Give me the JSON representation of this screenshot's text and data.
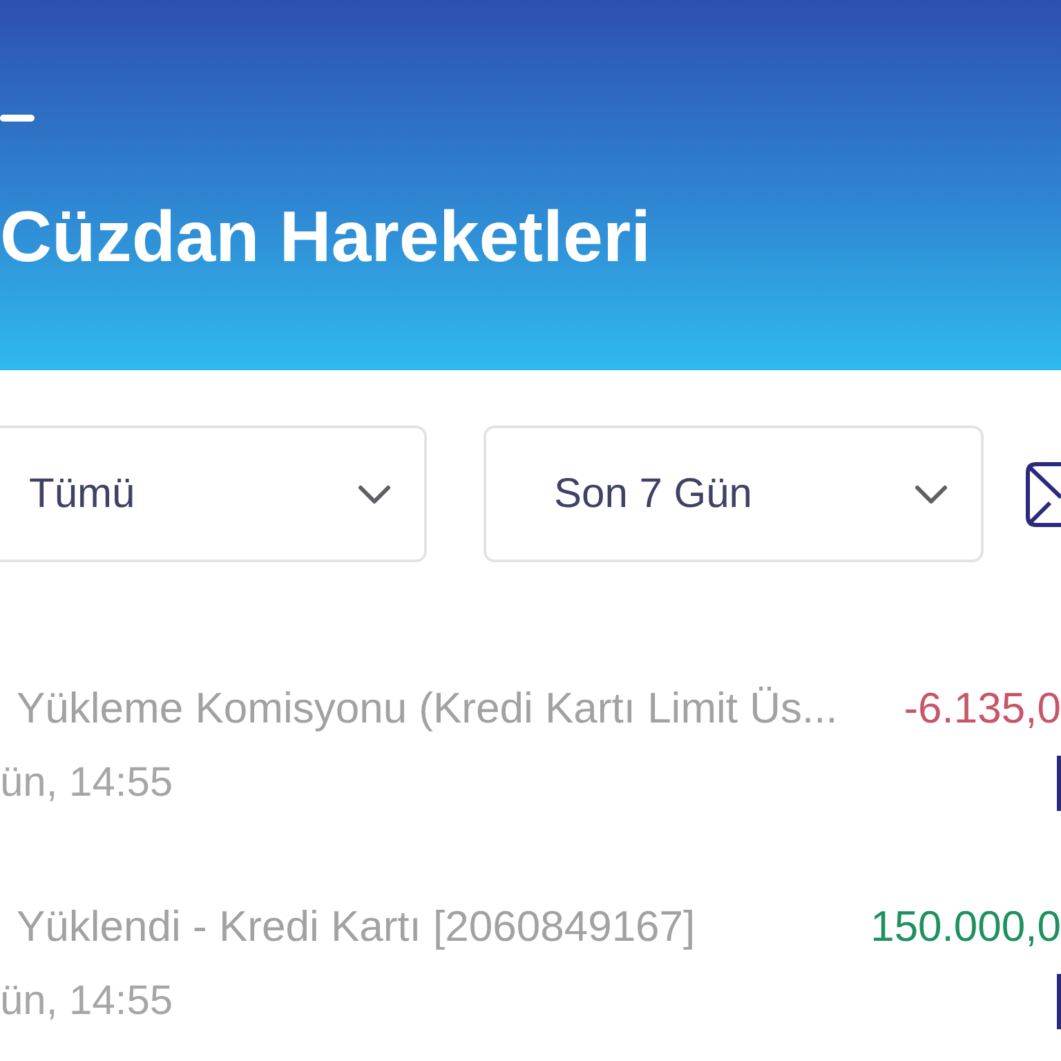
{
  "header": {
    "title": "Cüzdan Hareketleri"
  },
  "filters": [
    {
      "value": "Tümü"
    },
    {
      "value": "Son 7 Gün"
    }
  ],
  "transactions": [
    {
      "description": "Yükleme Komisyonu (Kredi Kartı Limit Üs...",
      "amount": "-6.135,0",
      "kind": "debit",
      "date": "ün, 14:55"
    },
    {
      "description": "Yüklendi - Kredi Kartı [2060849167]",
      "amount": "150.000,0",
      "kind": "credit",
      "date": "ün, 14:55"
    }
  ]
}
